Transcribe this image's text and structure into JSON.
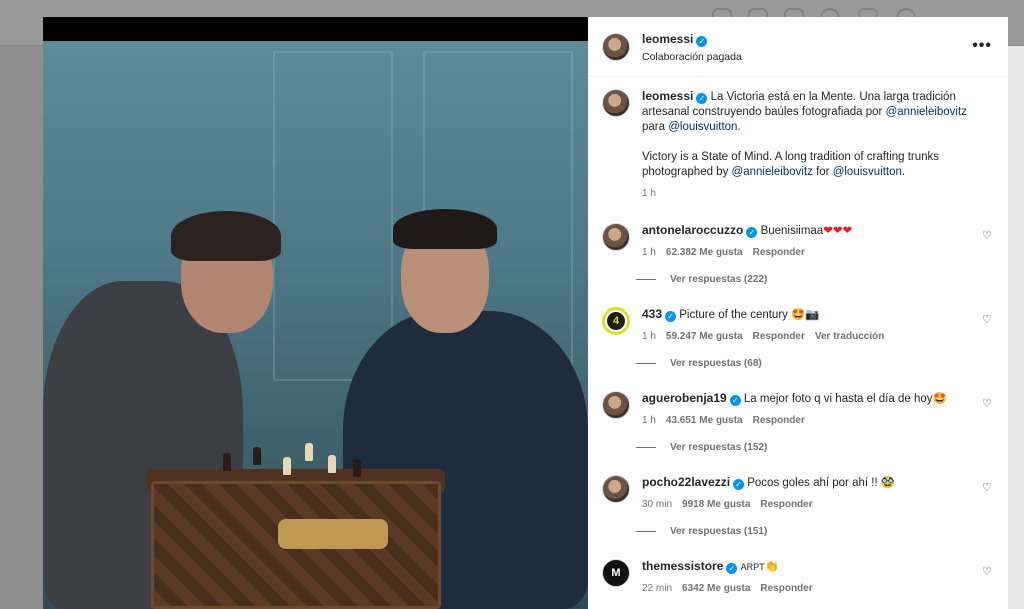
{
  "post": {
    "author": "leomessi",
    "subtitle": "Colaboración pagada",
    "more_label": "•••",
    "caption_es_start": "La Victoria está en la Mente. Una larga tradición artesanal construyendo baúles fotografiada por ",
    "caption_es_mention1": "@annieleibovitz",
    "caption_es_mid": " para ",
    "caption_es_mention2": "@louisvuitton",
    "caption_es_end": ".",
    "caption_en_start": "Victory is a State of Mind. A long tradition of crafting trunks photographed by ",
    "caption_en_mention1": "@annieleibovitz",
    "caption_en_mid": " for ",
    "caption_en_mention2": "@louisvuitton",
    "caption_en_end": ".",
    "time": "1 h"
  },
  "comments": [
    {
      "user": "antonelaroccuzzo",
      "text": "Buenisiimaa",
      "emoji": "❤❤❤",
      "time": "1 h",
      "likes": "62.382 Me gusta",
      "reply": "Responder",
      "translate": "",
      "replies": "Ver respuestas (222)"
    },
    {
      "user": "433",
      "text": "Picture of the century",
      "emoji": "🤩📷",
      "time": "1 h",
      "likes": "59.247 Me gusta",
      "reply": "Responder",
      "translate": "Ver traducción",
      "replies": "Ver respuestas (68)"
    },
    {
      "user": "aguerobenja19",
      "text": "La mejor foto q vi hasta el día de hoy",
      "emoji": "🤩",
      "time": "1 h",
      "likes": "43.651 Me gusta",
      "reply": "Responder",
      "translate": "",
      "replies": "Ver respuestas (152)"
    },
    {
      "user": "pocho22lavezzi",
      "text": "Pocos goles ahí por ahí !!",
      "emoji": "🥸",
      "time": "30 min",
      "likes": "9918 Me gusta",
      "reply": "Responder",
      "translate": "",
      "replies": "Ver respuestas (151)"
    },
    {
      "user": "themessistore",
      "text": "ARPT",
      "emoji": "👏",
      "time": "22 min",
      "likes": "6342 Me gusta",
      "reply": "Responder",
      "translate": "",
      "replies": ""
    }
  ],
  "icons": {
    "verified": "verified-badge-icon",
    "like": "heart-outline-icon",
    "more": "more-options-icon"
  },
  "colors": {
    "accent": "#0095f6",
    "mention": "#00376b",
    "muted": "#737373"
  }
}
